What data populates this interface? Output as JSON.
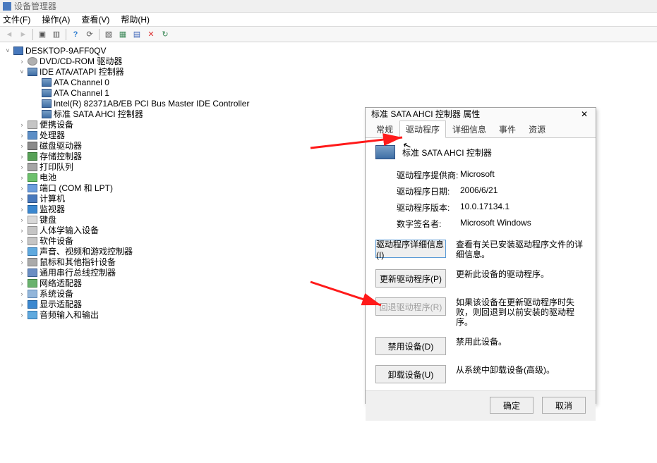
{
  "window": {
    "title": "设备管理器"
  },
  "menu": {
    "file": "文件(F)",
    "action": "操作(A)",
    "view": "查看(V)",
    "help": "帮助(H)"
  },
  "toolbar": {
    "back": "◄",
    "forward": "►",
    "up_tree": "▣",
    "view_toggle": "▥",
    "help": "?",
    "refresh": "⟳",
    "prop": "▧",
    "enable": "▦",
    "installed": "▤",
    "remove": "✕",
    "update": "↻"
  },
  "tree": {
    "root": "DESKTOP-9AFF0QV",
    "cat_dvd": "DVD/CD-ROM 驱动器",
    "cat_ide": "IDE ATA/ATAPI 控制器",
    "ide_0": "ATA Channel 0",
    "ide_1": "ATA Channel 1",
    "ide_intel": "Intel(R) 82371AB/EB PCI Bus Master IDE Controller",
    "ide_sata": "标准 SATA AHCI 控制器",
    "cat_portable": "便携设备",
    "cat_cpu": "处理器",
    "cat_disk": "磁盘驱动器",
    "cat_storage": "存储控制器",
    "cat_printer": "打印队列",
    "cat_battery": "电池",
    "cat_ports": "端口 (COM 和 LPT)",
    "cat_computer": "计算机",
    "cat_monitor": "监视器",
    "cat_keyboard": "键盘",
    "cat_hid": "人体学输入设备",
    "cat_software": "软件设备",
    "cat_sound": "声音、视频和游戏控制器",
    "cat_mouse": "鼠标和其他指针设备",
    "cat_usb": "通用串行总线控制器",
    "cat_net": "网络适配器",
    "cat_system": "系统设备",
    "cat_display": "显示适配器",
    "cat_audioio": "音频输入和输出"
  },
  "dialog": {
    "title": "标准 SATA AHCI 控制器 属性",
    "tabs": {
      "general": "常规",
      "driver": "驱动程序",
      "details": "详细信息",
      "events": "事件",
      "resources": "资源"
    },
    "device_name": "标准 SATA AHCI 控制器",
    "provider_k": "驱动程序提供商:",
    "provider_v": "Microsoft",
    "date_k": "驱动程序日期:",
    "date_v": "2006/6/21",
    "version_k": "驱动程序版本:",
    "version_v": "10.0.17134.1",
    "signer_k": "数字签名者:",
    "signer_v": "Microsoft Windows",
    "btn_details": "驱动程序详细信息(I)",
    "desc_details": "查看有关已安装驱动程序文件的详细信息。",
    "btn_update": "更新驱动程序(P)",
    "desc_update": "更新此设备的驱动程序。",
    "btn_rollback": "回退驱动程序(R)",
    "desc_rollback": "如果该设备在更新驱动程序时失败，则回退到以前安装的驱动程序。",
    "btn_disable": "禁用设备(D)",
    "desc_disable": "禁用此设备。",
    "btn_uninstall": "卸载设备(U)",
    "desc_uninstall": "从系统中卸载设备(高级)。",
    "ok": "确定",
    "cancel": "取消"
  }
}
